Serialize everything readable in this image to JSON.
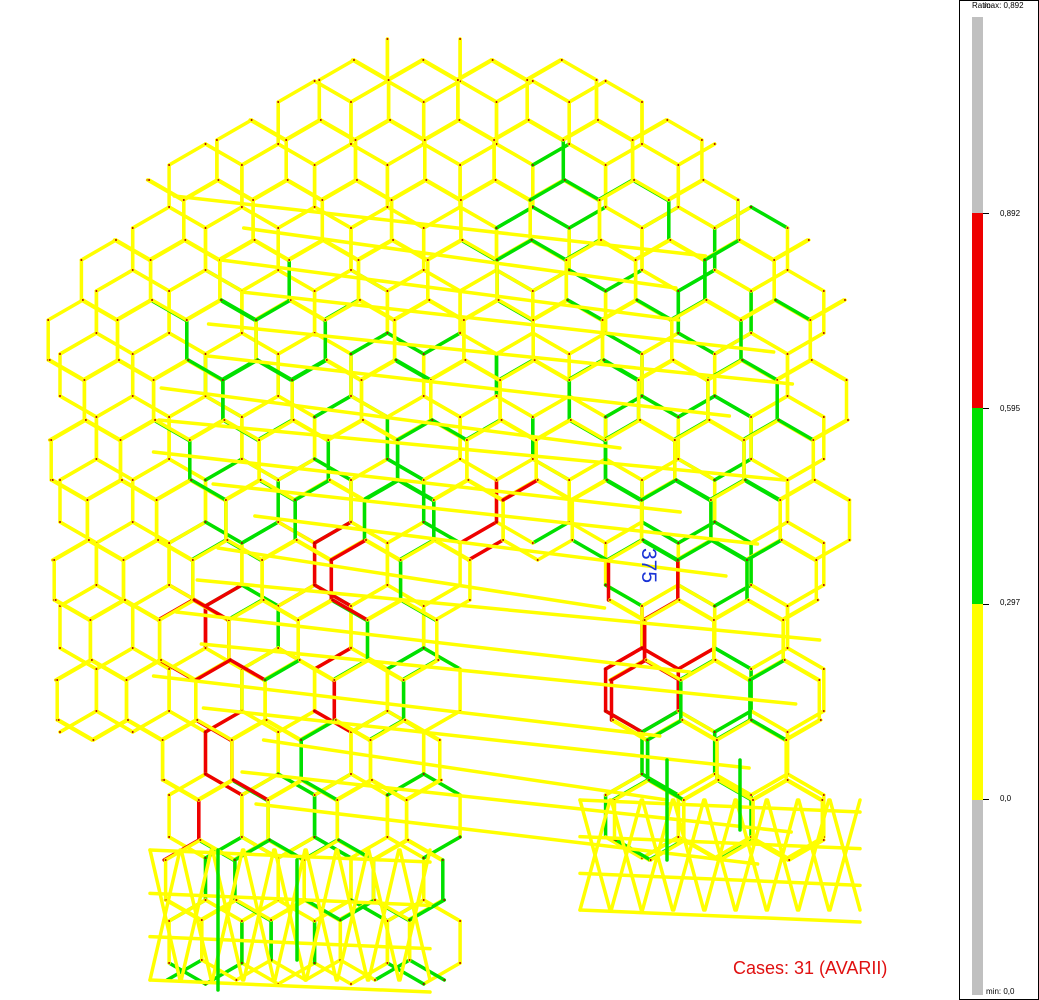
{
  "model_view": {
    "member_label": "375",
    "cases_label": "Cases: 31 (AVARII)",
    "colors": {
      "yellow": "#ffff00",
      "green": "#00e000",
      "red": "#ee0000",
      "label_blue": "#1a33d6",
      "cases_red": "#e01010"
    }
  },
  "legend": {
    "title": "Ratio",
    "max_label": "max: 0,892",
    "min_label": "min:  0,0",
    "levels": [
      {
        "label": "0,892",
        "color": "#c0c0c0"
      },
      {
        "label": "0,595",
        "color": "#ee0000"
      },
      {
        "label": "0,297",
        "color": "#00e000"
      },
      {
        "label": "0,0",
        "color": "#ffff00"
      },
      {
        "label": "",
        "color": "#c0c0c0"
      }
    ]
  }
}
